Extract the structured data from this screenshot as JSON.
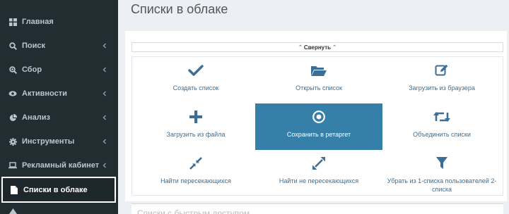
{
  "sidebar": {
    "items": [
      {
        "label": "Главная",
        "icon": "dashboard-icon",
        "has_chevron": false
      },
      {
        "label": "Поиск",
        "icon": "search-icon",
        "has_chevron": true
      },
      {
        "label": "Сбор",
        "icon": "zoom-icon",
        "has_chevron": true
      },
      {
        "label": "Активности",
        "icon": "eye-icon",
        "has_chevron": true
      },
      {
        "label": "Анализ",
        "icon": "pie-chart-icon",
        "has_chevron": true
      },
      {
        "label": "Инструменты",
        "icon": "gear-icon",
        "has_chevron": true
      },
      {
        "label": "Рекламный кабинет",
        "icon": "laptop-icon",
        "has_chevron": true
      },
      {
        "label": "Списки в облаке",
        "icon": "file-icon",
        "has_chevron": false,
        "active": true
      }
    ]
  },
  "main": {
    "title": "Списки в облаке",
    "collapse_label": "Свернуть",
    "tiles": [
      {
        "label": "Создать список",
        "icon": "check-icon"
      },
      {
        "label": "Открыть список",
        "icon": "folder-open-icon"
      },
      {
        "label": "Загрузить из браузера",
        "icon": "edit-icon"
      },
      {
        "label": "Загрузить из файла",
        "icon": "plus-icon"
      },
      {
        "label": "Сохранить в ретаргет",
        "icon": "target-icon",
        "primary": true
      },
      {
        "label": "Объединить списки",
        "icon": "retweet-icon"
      },
      {
        "label": "Найти пересекающихся",
        "icon": "compress-icon"
      },
      {
        "label": "Найти не пересекающихся",
        "icon": "expand-icon"
      },
      {
        "label": "Убрать из 1-списка пользователей 2-списка",
        "icon": "filter-icon"
      }
    ],
    "bottom_partial_text": "Списки с быстрым доступом"
  },
  "colors": {
    "sidebar_bg": "#222d32",
    "sidebar_text": "#b8c7ce",
    "accent": "#367fa9",
    "link": "#3c6e96",
    "page_bg": "#ecf0f5"
  }
}
